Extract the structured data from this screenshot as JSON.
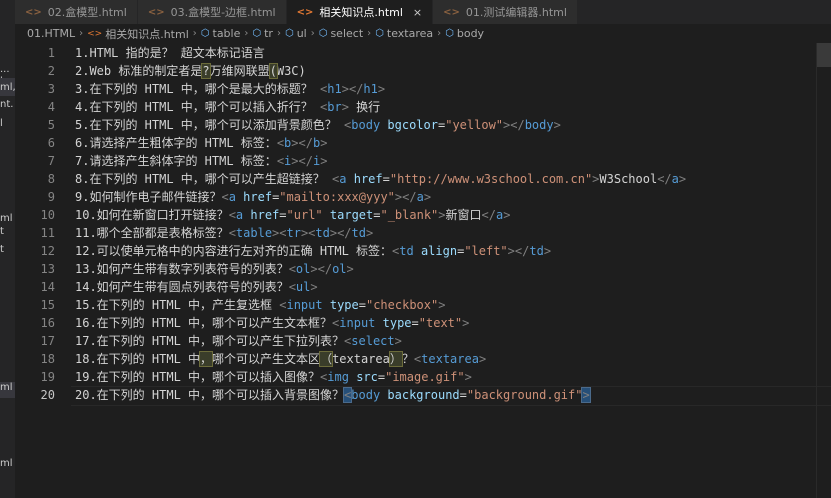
{
  "sidebar_fragments": [
    "...",
    "l",
    "ml,",
    "nt.",
    "l",
    "ml",
    "t",
    "t",
    "ml",
    "ml"
  ],
  "tabs": [
    {
      "label": "02.盒模型.html",
      "icon": "<>",
      "active": false
    },
    {
      "label": "03.盒模型-边框.html",
      "icon": "<>",
      "active": false
    },
    {
      "label": "相关知识点.html",
      "icon": "<>",
      "active": true,
      "close": "×"
    },
    {
      "label": "01.测试编辑器.html",
      "icon": "<>",
      "active": false
    }
  ],
  "breadcrumb": [
    "01.HTML",
    "相关知识点.html",
    "table",
    "tr",
    "ul",
    "select",
    "textarea",
    "body"
  ],
  "breadcrumb_icons": {
    "file": "<>",
    "element": "cube-icon"
  },
  "active_line": 20,
  "lines": [
    {
      "n": "1",
      "parts": [
        [
          "t",
          "1.HTML 指的是？ 超文本标记语言"
        ]
      ]
    },
    {
      "n": "2",
      "parts": [
        [
          "t",
          "2.Web 标准的制定者是"
        ],
        [
          "hl",
          "?"
        ],
        [
          "t",
          "万维网联盟"
        ],
        [
          "hl",
          "("
        ],
        [
          "t",
          "W3C)"
        ]
      ]
    },
    {
      "n": "3",
      "parts": [
        [
          "t",
          "3.在下列的 HTML 中，哪个是最大的标题？ "
        ],
        [
          "g",
          "<"
        ],
        [
          "n",
          "h1"
        ],
        [
          "g",
          "></"
        ],
        [
          "n",
          "h1"
        ],
        [
          "g",
          ">"
        ]
      ]
    },
    {
      "n": "4",
      "parts": [
        [
          "t",
          "4.在下列的 HTML 中，哪个可以插入折行？ "
        ],
        [
          "g",
          "<"
        ],
        [
          "n",
          "br"
        ],
        [
          "g",
          ">"
        ],
        [
          "t",
          " 换行"
        ]
      ]
    },
    {
      "n": "5",
      "parts": [
        [
          "t",
          "5.在下列的 HTML 中，哪个可以添加背景颜色？ "
        ],
        [
          "g",
          "<"
        ],
        [
          "n",
          "body"
        ],
        [
          "t",
          " "
        ],
        [
          "a",
          "bgcolor"
        ],
        [
          "t",
          "="
        ],
        [
          "v",
          "\"yellow\""
        ],
        [
          "g",
          "></"
        ],
        [
          "n",
          "body"
        ],
        [
          "g",
          ">"
        ]
      ]
    },
    {
      "n": "6",
      "parts": [
        [
          "t",
          "6.请选择产生粗体字的 HTML 标签："
        ],
        [
          "g",
          "<"
        ],
        [
          "n",
          "b"
        ],
        [
          "g",
          "></"
        ],
        [
          "n",
          "b"
        ],
        [
          "g",
          ">"
        ]
      ]
    },
    {
      "n": "7",
      "parts": [
        [
          "t",
          "7.请选择产生斜体字的 HTML 标签："
        ],
        [
          "g",
          "<"
        ],
        [
          "n",
          "i"
        ],
        [
          "g",
          "></"
        ],
        [
          "n",
          "i"
        ],
        [
          "g",
          ">"
        ]
      ]
    },
    {
      "n": "8",
      "parts": [
        [
          "t",
          "8.在下列的 HTML 中，哪个可以产生超链接？ "
        ],
        [
          "g",
          "<"
        ],
        [
          "n",
          "a"
        ],
        [
          "t",
          " "
        ],
        [
          "a",
          "href"
        ],
        [
          "t",
          "="
        ],
        [
          "v",
          "\"http://www.w3school.com.cn\""
        ],
        [
          "g",
          ">"
        ],
        [
          "t",
          "W3School"
        ],
        [
          "g",
          "</"
        ],
        [
          "n",
          "a"
        ],
        [
          "g",
          ">"
        ]
      ]
    },
    {
      "n": "9",
      "parts": [
        [
          "t",
          "9.如何制作电子邮件链接？"
        ],
        [
          "g",
          "<"
        ],
        [
          "n",
          "a"
        ],
        [
          "t",
          " "
        ],
        [
          "a",
          "href"
        ],
        [
          "t",
          "="
        ],
        [
          "v",
          "\"mailto:xxx@yyy\""
        ],
        [
          "g",
          "></"
        ],
        [
          "n",
          "a"
        ],
        [
          "g",
          ">"
        ]
      ]
    },
    {
      "n": "10",
      "parts": [
        [
          "t",
          "10.如何在新窗口打开链接？"
        ],
        [
          "g",
          "<"
        ],
        [
          "n",
          "a"
        ],
        [
          "t",
          " "
        ],
        [
          "a",
          "href"
        ],
        [
          "t",
          "="
        ],
        [
          "v",
          "\"url\""
        ],
        [
          "t",
          " "
        ],
        [
          "a",
          "target"
        ],
        [
          "t",
          "="
        ],
        [
          "v",
          "\"_blank\""
        ],
        [
          "g",
          ">"
        ],
        [
          "t",
          "新窗口"
        ],
        [
          "g",
          "</"
        ],
        [
          "n",
          "a"
        ],
        [
          "g",
          ">"
        ]
      ]
    },
    {
      "n": "11",
      "parts": [
        [
          "t",
          "11.哪个全部都是表格标签？"
        ],
        [
          "g",
          "<"
        ],
        [
          "n",
          "table"
        ],
        [
          "g",
          "><"
        ],
        [
          "n",
          "tr"
        ],
        [
          "g",
          "><"
        ],
        [
          "n",
          "td"
        ],
        [
          "g",
          "></"
        ],
        [
          "n",
          "td"
        ],
        [
          "g",
          ">"
        ]
      ]
    },
    {
      "n": "12",
      "parts": [
        [
          "t",
          "12.可以使单元格中的内容进行左对齐的正确 HTML 标签："
        ],
        [
          "g",
          "<"
        ],
        [
          "n",
          "td"
        ],
        [
          "t",
          " "
        ],
        [
          "a",
          "align"
        ],
        [
          "t",
          "="
        ],
        [
          "v",
          "\"left\""
        ],
        [
          "g",
          "></"
        ],
        [
          "n",
          "td"
        ],
        [
          "g",
          ">"
        ]
      ]
    },
    {
      "n": "13",
      "parts": [
        [
          "t",
          "13.如何产生带有数字列表符号的列表？"
        ],
        [
          "g",
          "<"
        ],
        [
          "n",
          "ol"
        ],
        [
          "g",
          "></"
        ],
        [
          "n",
          "ol"
        ],
        [
          "g",
          ">"
        ]
      ]
    },
    {
      "n": "14",
      "parts": [
        [
          "t",
          "14.如何产生带有圆点列表符号的列表？"
        ],
        [
          "g",
          "<"
        ],
        [
          "n",
          "ul"
        ],
        [
          "g",
          ">"
        ]
      ]
    },
    {
      "n": "15",
      "parts": [
        [
          "t",
          "15.在下列的 HTML 中，产生复选框 "
        ],
        [
          "g",
          "<"
        ],
        [
          "n",
          "input"
        ],
        [
          "t",
          " "
        ],
        [
          "a",
          "type"
        ],
        [
          "t",
          "="
        ],
        [
          "v",
          "\"checkbox\""
        ],
        [
          "g",
          ">"
        ]
      ]
    },
    {
      "n": "16",
      "parts": [
        [
          "t",
          "16.在下列的 HTML 中，哪个可以产生文本框？"
        ],
        [
          "g",
          "<"
        ],
        [
          "n",
          "input"
        ],
        [
          "t",
          " "
        ],
        [
          "a",
          "type"
        ],
        [
          "t",
          "="
        ],
        [
          "v",
          "\"text\""
        ],
        [
          "g",
          ">"
        ]
      ]
    },
    {
      "n": "17",
      "parts": [
        [
          "t",
          "17.在下列的 HTML 中，哪个可以产生下拉列表？"
        ],
        [
          "g",
          "<"
        ],
        [
          "n",
          "select"
        ],
        [
          "g",
          ">"
        ]
      ]
    },
    {
      "n": "18",
      "parts": [
        [
          "t",
          "18.在下列的 HTML 中"
        ],
        [
          "hl",
          "，"
        ],
        [
          "t",
          "哪个可以产生文本区"
        ],
        [
          "hl",
          "（"
        ],
        [
          "t",
          "textarea"
        ],
        [
          "hl",
          "）"
        ],
        [
          "t",
          "？"
        ],
        [
          "g",
          "<"
        ],
        [
          "n",
          "textarea"
        ],
        [
          "g",
          ">"
        ]
      ]
    },
    {
      "n": "19",
      "parts": [
        [
          "t",
          "19.在下列的 HTML 中，哪个可以插入图像？"
        ],
        [
          "g",
          "<"
        ],
        [
          "n",
          "img"
        ],
        [
          "t",
          " "
        ],
        [
          "a",
          "src"
        ],
        [
          "t",
          "="
        ],
        [
          "v",
          "\"image.gif\""
        ],
        [
          "g",
          ">"
        ]
      ]
    },
    {
      "n": "20",
      "parts": [
        [
          "t",
          "20.在下列的 HTML 中，哪个可以插入背景图像？"
        ],
        [
          "hb",
          "<"
        ],
        [
          "n",
          "body"
        ],
        [
          "t",
          " "
        ],
        [
          "a",
          "background"
        ],
        [
          "t",
          "="
        ],
        [
          "v",
          "\"background.gif\""
        ],
        [
          "hb",
          ">"
        ]
      ]
    }
  ]
}
